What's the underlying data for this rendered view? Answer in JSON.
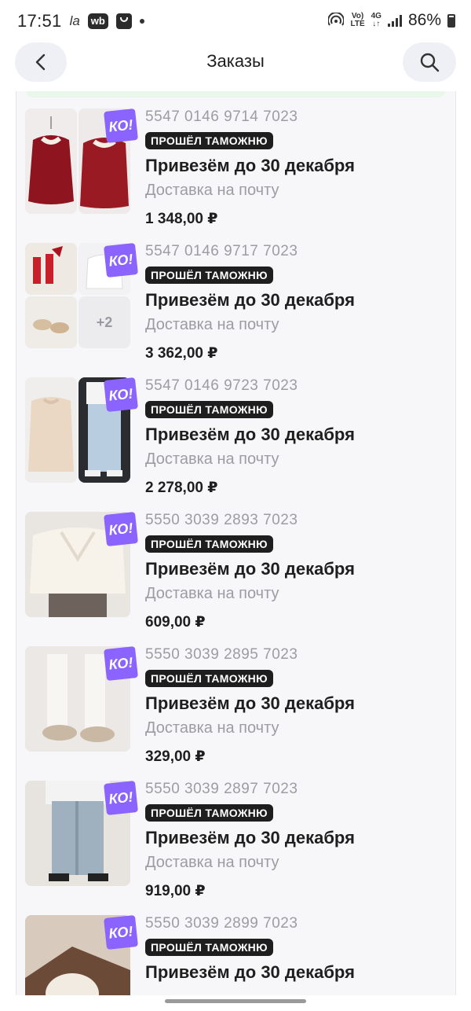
{
  "status_bar": {
    "time": "17:51",
    "carrier_mark": "la",
    "wb_badge": "wb",
    "volte_top": "Vo)",
    "volte_bottom": "LTE",
    "net_top": "4G",
    "net_bottom": "↓↑",
    "battery_percent": "86%"
  },
  "header": {
    "title": "Заказы",
    "back_icon": "chevron-left-icon",
    "search_icon": "search-icon"
  },
  "badge_text": "КО!",
  "orders": [
    {
      "track": "5547 0146 9714 7023",
      "customs": "ПРОШЁЛ ТАМОЖНЮ",
      "date": "Привезём до 30 декабря",
      "method": "Доставка на почту",
      "price": "1 348,00 ₽"
    },
    {
      "track": "5547 0146 9717 7023",
      "customs": "ПРОШЁЛ ТАМОЖНЮ",
      "date": "Привезём до 30 декабря",
      "method": "Доставка на почту",
      "price": "3 362,00 ₽",
      "more": "+2"
    },
    {
      "track": "5547 0146 9723 7023",
      "customs": "ПРОШЁЛ ТАМОЖНЮ",
      "date": "Привезём до 30 декабря",
      "method": "Доставка на почту",
      "price": "2 278,00 ₽"
    },
    {
      "track": "5550 3039 2893 7023",
      "customs": "ПРОШЁЛ ТАМОЖНЮ",
      "date": "Привезём до 30 декабря",
      "method": "Доставка на почту",
      "price": "609,00 ₽"
    },
    {
      "track": "5550 3039 2895 7023",
      "customs": "ПРОШЁЛ ТАМОЖНЮ",
      "date": "Привезём до 30 декабря",
      "method": "Доставка на почту",
      "price": "329,00 ₽"
    },
    {
      "track": "5550 3039 2897 7023",
      "customs": "ПРОШЁЛ ТАМОЖНЮ",
      "date": "Привезём до 30 декабря",
      "method": "Доставка на почту",
      "price": "919,00 ₽"
    },
    {
      "track": "5550 3039 2899 7023",
      "customs": "ПРОШЁЛ ТАМОЖНЮ",
      "date": "Привезём до 30 декабря"
    }
  ],
  "colors": {
    "accent_purple": "#8b63ff",
    "customs_badge_bg": "#1e1e1e",
    "muted_text": "#9c9ca3",
    "header_button_bg": "#eef0f5"
  }
}
